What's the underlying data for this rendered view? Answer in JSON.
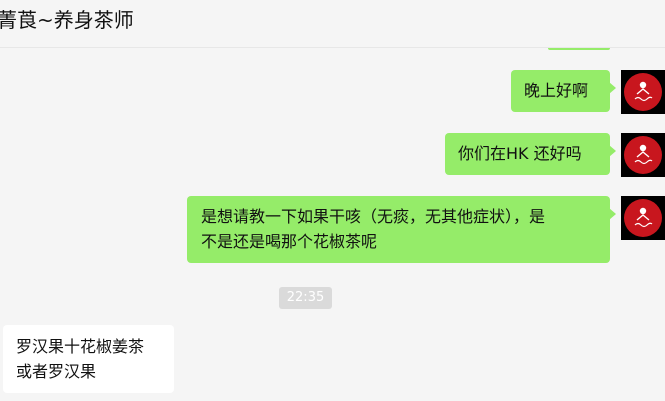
{
  "header": {
    "title": "菁莨~养身茶师"
  },
  "messages": [
    {
      "direction": "sent",
      "lines": [
        "晚上好啊"
      ]
    },
    {
      "direction": "sent",
      "lines": [
        "你们在HK 还好吗"
      ]
    },
    {
      "direction": "sent",
      "lines": [
        "是想请教一下如果干咳（无痰，无其他症状），是",
        "不是还是喝那个花椒茶呢"
      ]
    },
    {
      "direction": "time",
      "text": "22:35"
    },
    {
      "direction": "received",
      "lines": [
        "罗汉果十花椒姜茶",
        "或者罗汉果"
      ]
    }
  ],
  "colors": {
    "sent_bubble": "#95ec69",
    "received_bubble": "#ffffff",
    "background": "#f5f5f5",
    "avatar_background": "#000000",
    "avatar_circle": "#c8161e"
  },
  "icons": {
    "avatar": "avatar-icon"
  }
}
